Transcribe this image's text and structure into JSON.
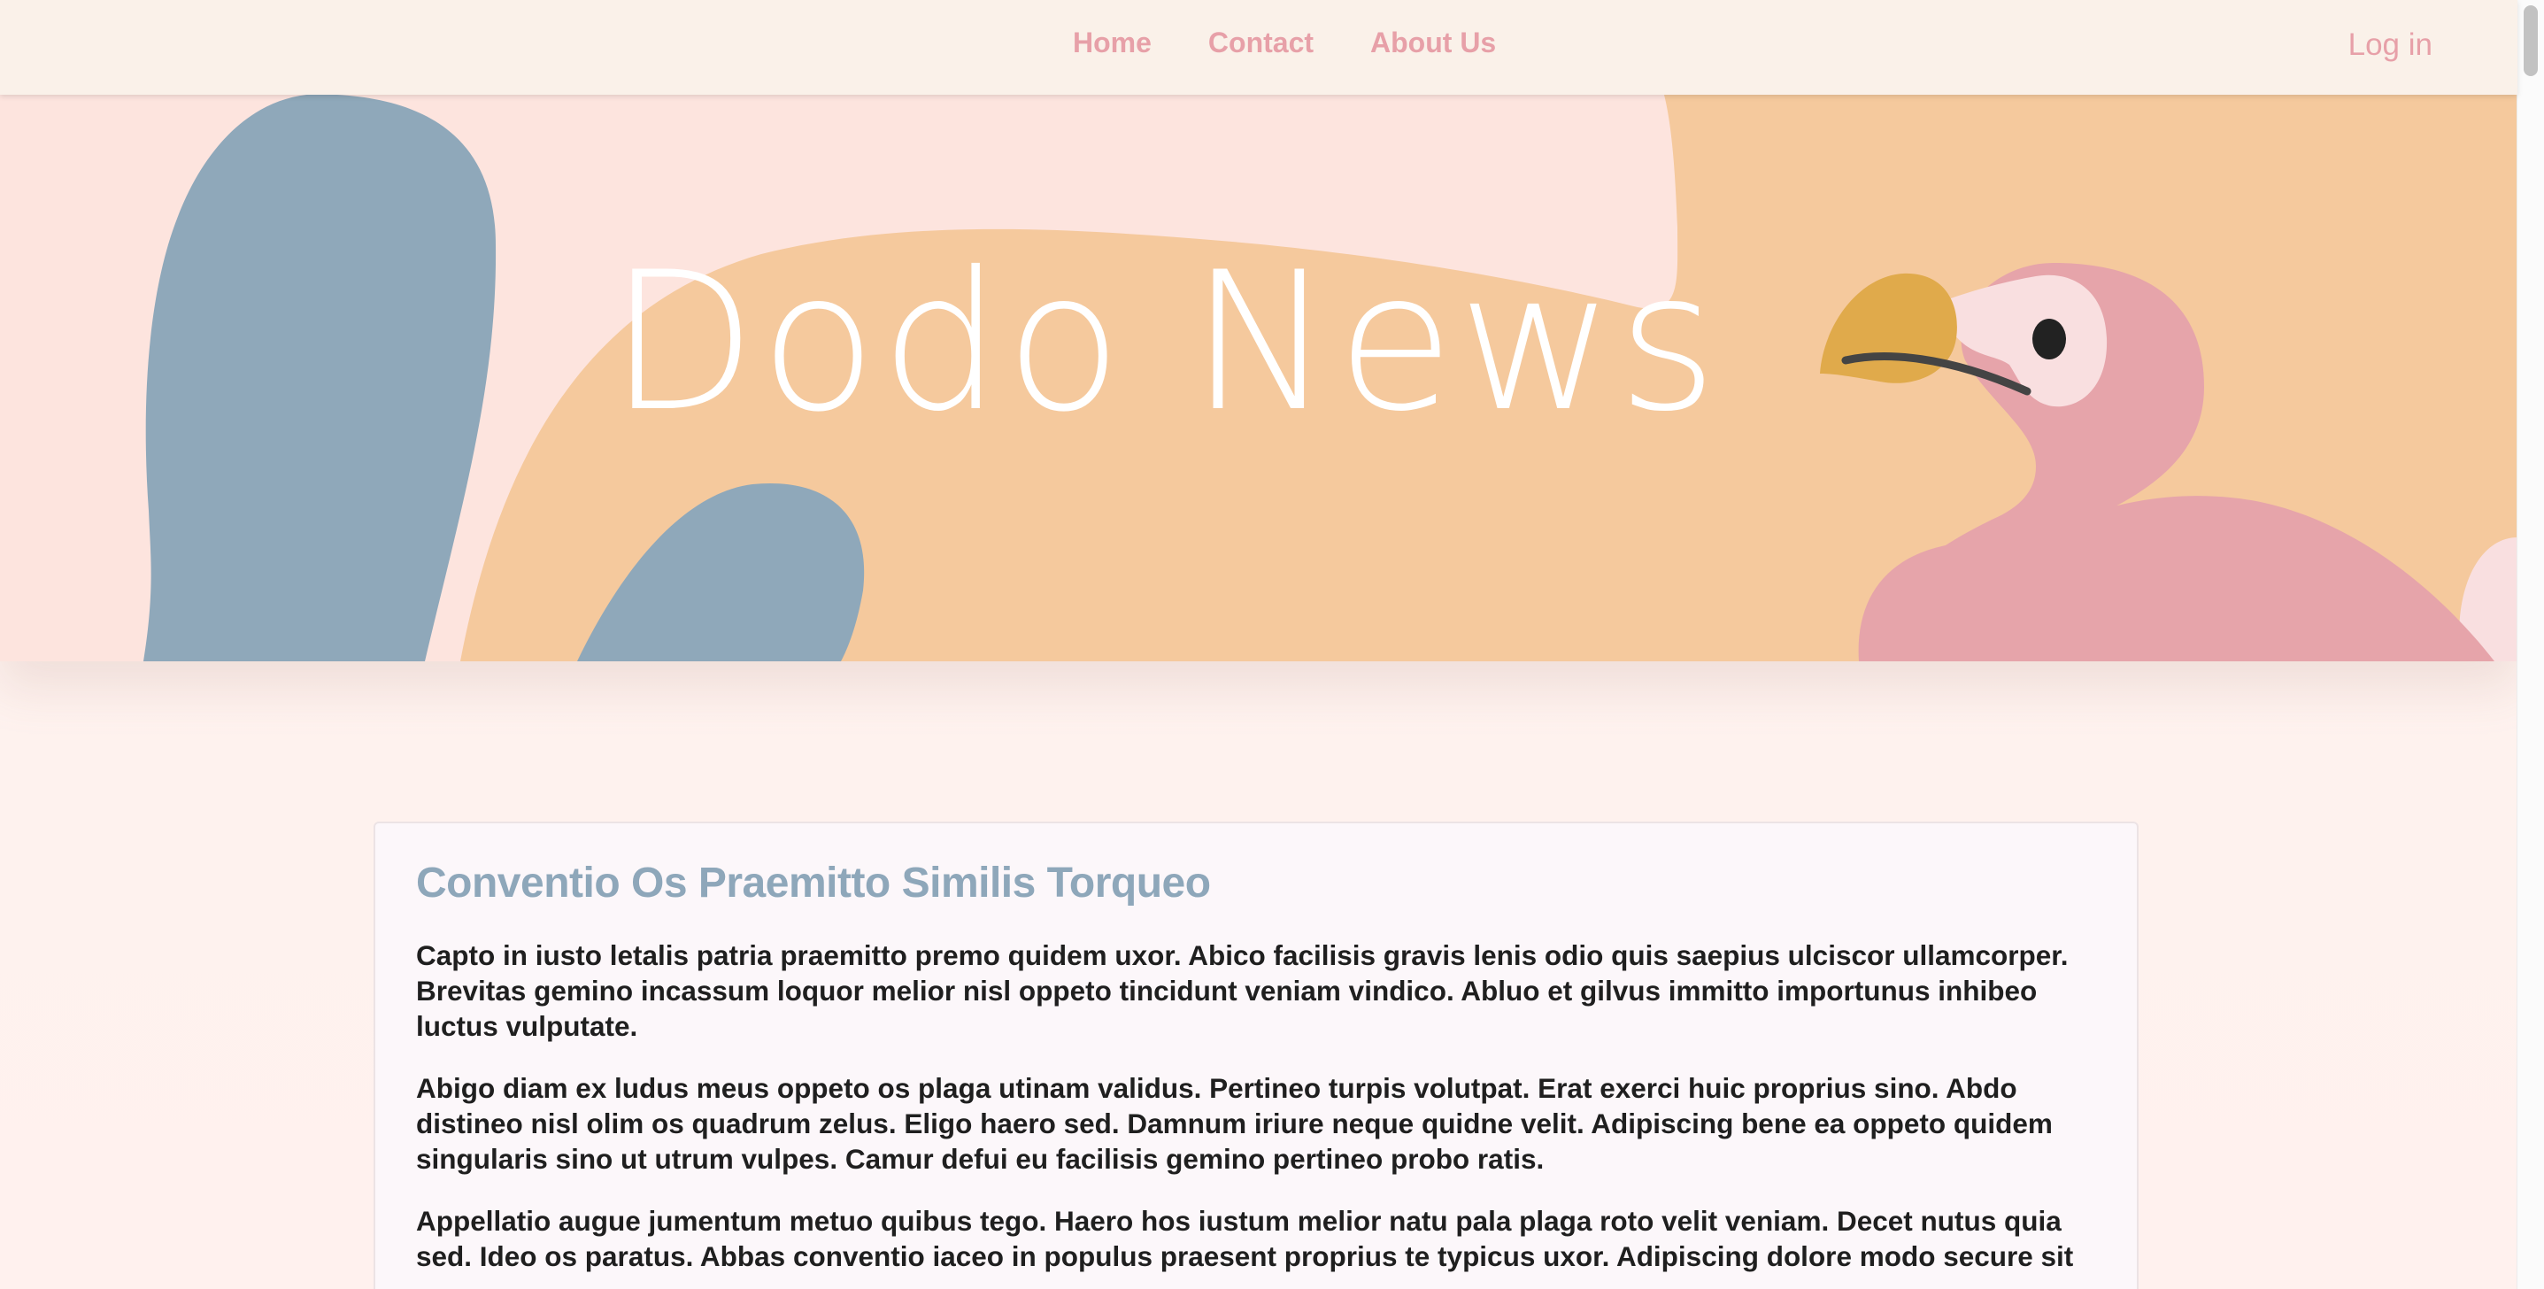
{
  "nav": {
    "items": [
      {
        "label": "Home"
      },
      {
        "label": "Contact"
      },
      {
        "label": "About Us"
      }
    ],
    "login_label": "Log in"
  },
  "hero": {
    "title": "Dodo News",
    "icon": "dodo-bird-illustration"
  },
  "article": {
    "title": "Conventio Os Praemitto Similis Torqueo",
    "paragraphs": [
      "Capto in iusto letalis patria praemitto premo quidem uxor. Abico facilisis gravis lenis odio quis saepius ulciscor ullamcorper. Brevitas gemino incassum loquor melior nisl oppeto tincidunt veniam vindico. Abluo et gilvus immitto importunus inhibeo luctus vulputate.",
      "Abigo diam ex ludus meus oppeto os plaga utinam validus. Pertineo turpis volutpat. Erat exerci huic proprius sino. Abdo distineo nisl olim os quadrum zelus. Eligo haero sed. Damnum iriure neque quidne velit. Adipiscing bene ea oppeto quidem singularis sino ut utrum vulpes. Camur defui eu facilisis gemino pertineo probo ratis.",
      "Appellatio augue jumentum metuo quibus tego. Haero hos iustum melior natu pala plaga roto velit veniam. Decet nutus quia sed. Ideo os paratus. Abbas conventio iaceo in populus praesent proprius te typicus uxor. Adipiscing dolore modo secure sit"
    ]
  },
  "colors": {
    "nav_bg": "#faf1e9",
    "nav_link": "#e7a0a8",
    "hero_orange": "#f5c99d",
    "hero_pink_bg": "#fde4de",
    "leaf_blue": "#8fa8ba",
    "dodo_pink": "#e6a4aa",
    "dodo_face": "#f9dfe0",
    "beak": "#e0aa4b",
    "heading": "#8ea7ba"
  }
}
